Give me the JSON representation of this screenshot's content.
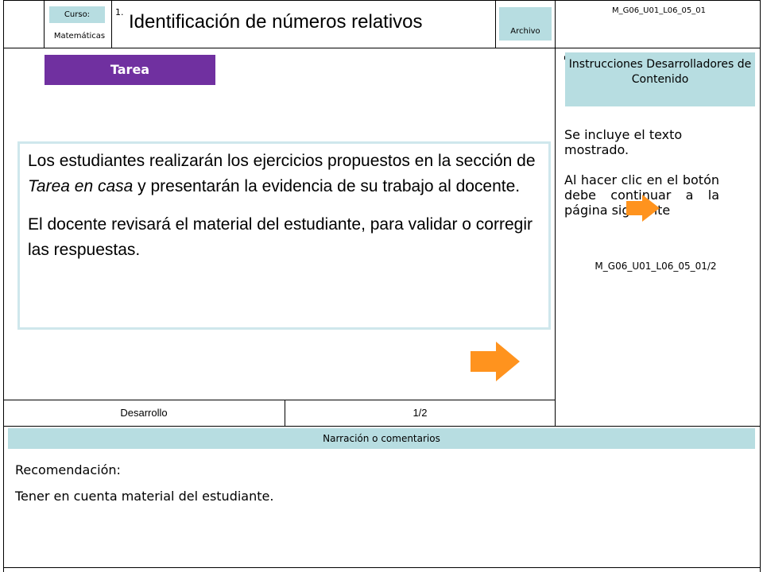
{
  "header": {
    "curso_label": "Curso:",
    "curso_value": "Matemáticas",
    "number": "1.",
    "title": "Identificación de números relativos",
    "archivo_label": "Archivo",
    "code": "M_G06_U01_L06_05_01"
  },
  "main": {
    "tarea_label": "Tarea",
    "paragraph1_part1": "Los estudiantes realizarán los ejercicios propuestos en la sección de ",
    "paragraph1_emphasis": "Tarea en casa",
    "paragraph1_part2": " y presentarán la evidencia de su trabajo al docente.",
    "paragraph2": "El docente revisará el material del estudiante, para validar o corregir las respuestas.",
    "next_icon": "orange-right-arrow"
  },
  "sidebar": {
    "instructions_title": "Instrucciones Desarrolladores de Contenido",
    "text1": "Se incluye el texto mostrado.",
    "text2": "Al hacer clic en el botón            debe continuar a la página siguiente",
    "arrow_icon": "orange-right-arrow",
    "code": "M_G06_U01_L06_05_01/2"
  },
  "footer": {
    "section": "Desarrollo",
    "page": "1/2"
  },
  "notes": {
    "header": "Narración o comentarios",
    "label": "Recomendación:",
    "text": "Tener en cuenta material del estudiante."
  },
  "colors": {
    "accent_purple": "#7030a0",
    "light_teal": "#b7dde1",
    "arrow_orange": "#ff931e"
  }
}
